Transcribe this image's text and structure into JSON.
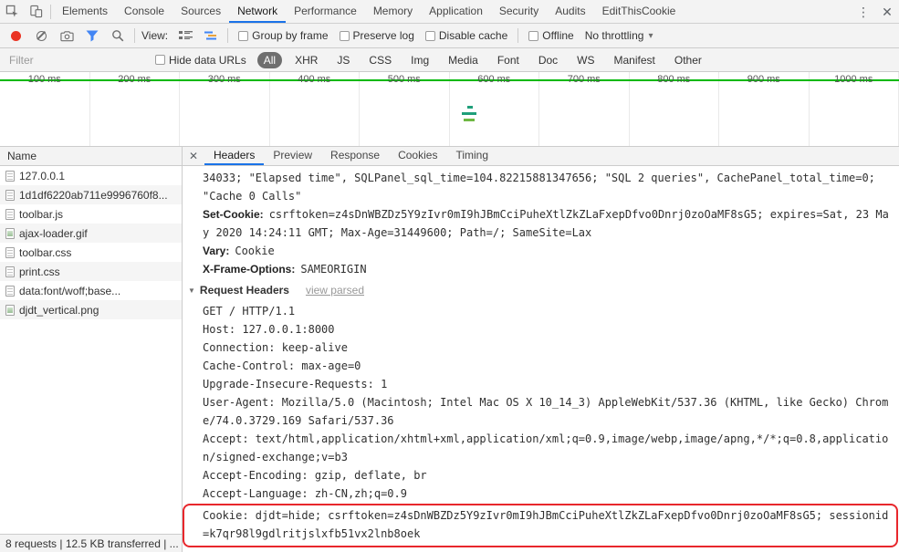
{
  "colors": {
    "accent_blue": "#1a73e8",
    "filter_active_blue": "#4285f4",
    "record_red": "#ea3323",
    "overview_green": "#00b906",
    "selected_pill_bg": "#6e6e6e",
    "highlight_red": "#e8272c",
    "waterfall_bar_teal": "#1f9f7a",
    "waterfall_bar_green": "#6fb843",
    "toolbar_icon_orange": "#e8a33d"
  },
  "icons": {
    "more_menu": "⋮",
    "close": "✕",
    "dropdown_arrow": "▾",
    "disclosure_triangle": "▼"
  },
  "devtools_tabs": {
    "items": [
      "Elements",
      "Console",
      "Sources",
      "Network",
      "Performance",
      "Memory",
      "Application",
      "Security",
      "Audits",
      "EditThisCookie"
    ],
    "selected": "Network"
  },
  "network_toolbar": {
    "view_label": "View:",
    "checkboxes": [
      "Group by frame",
      "Preserve log",
      "Disable cache"
    ],
    "offline_label": "Offline",
    "throttling_value": "No throttling"
  },
  "filter_bar": {
    "filter_placeholder": "Filter",
    "hide_data_urls_label": "Hide data URLs",
    "type_filters": [
      "All",
      "XHR",
      "JS",
      "CSS",
      "Img",
      "Media",
      "Font",
      "Doc",
      "WS",
      "Manifest",
      "Other"
    ],
    "selected_filter": "All"
  },
  "timeline": {
    "ticks": [
      "100 ms",
      "200 ms",
      "300 ms",
      "400 ms",
      "500 ms",
      "600 ms",
      "700 ms",
      "800 ms",
      "900 ms",
      "1000 ms"
    ]
  },
  "request_list": {
    "name_header": "Name",
    "items": [
      {
        "label": "127.0.0.1",
        "type": "doc"
      },
      {
        "label": "1d1df6220ab711e9996760f8...",
        "type": "script"
      },
      {
        "label": "toolbar.js",
        "type": "script"
      },
      {
        "label": "ajax-loader.gif",
        "type": "image"
      },
      {
        "label": "toolbar.css",
        "type": "css"
      },
      {
        "label": "print.css",
        "type": "css"
      },
      {
        "label": "data:font/woff;base...",
        "type": "font"
      },
      {
        "label": "djdt_vertical.png",
        "type": "image"
      }
    ]
  },
  "detail_pane": {
    "tabs": [
      "Headers",
      "Preview",
      "Response",
      "Cookies",
      "Timing"
    ],
    "selected_tab": "Headers",
    "response_overflow_line": "34033; \"Elapsed time\", SQLPanel_sql_time=104.82215881347656; \"SQL 2 queries\", CachePanel_total_time=0; \"Cache 0 Calls\"",
    "response_headers": [
      {
        "name": "Set-Cookie:",
        "value": "csrftoken=z4sDnWBZDz5Y9zIvr0mI9hJBmCciPuheXtlZkZLaFxepDfvo0Dnrj0zoOaMF8sG5; expires=Sat, 23 May 2020 14:24:11 GMT; Max-Age=31449600; Path=/; SameSite=Lax"
      },
      {
        "name": "Vary:",
        "value": "Cookie"
      },
      {
        "name": "X-Frame-Options:",
        "value": "SAMEORIGIN"
      }
    ],
    "request_headers_title": "Request Headers",
    "view_parsed_label": "view parsed",
    "request_raw_lines": [
      "GET / HTTP/1.1",
      "Host: 127.0.0.1:8000",
      "Connection: keep-alive",
      "Cache-Control: max-age=0",
      "Upgrade-Insecure-Requests: 1",
      "User-Agent: Mozilla/5.0 (Macintosh; Intel Mac OS X 10_14_3) AppleWebKit/537.36 (KHTML, like Gecko) Chrome/74.0.3729.169 Safari/537.36",
      "Accept: text/html,application/xhtml+xml,application/xml;q=0.9,image/webp,image/apng,*/*;q=0.8,application/signed-exchange;v=b3",
      "Accept-Encoding: gzip, deflate, br",
      "Accept-Language: zh-CN,zh;q=0.9"
    ],
    "highlighted_cookie_line": "Cookie: djdt=hide; csrftoken=z4sDnWBZDz5Y9zIvr0mI9hJBmCciPuheXtlZkZLaFxepDfvo0Dnrj0zoOaMF8sG5; sessionid=k7qr98l9gdlritjslxfb51vx2lnb8oek"
  },
  "status_bar": {
    "text": "8 requests | 12.5 KB transferred | ..."
  }
}
